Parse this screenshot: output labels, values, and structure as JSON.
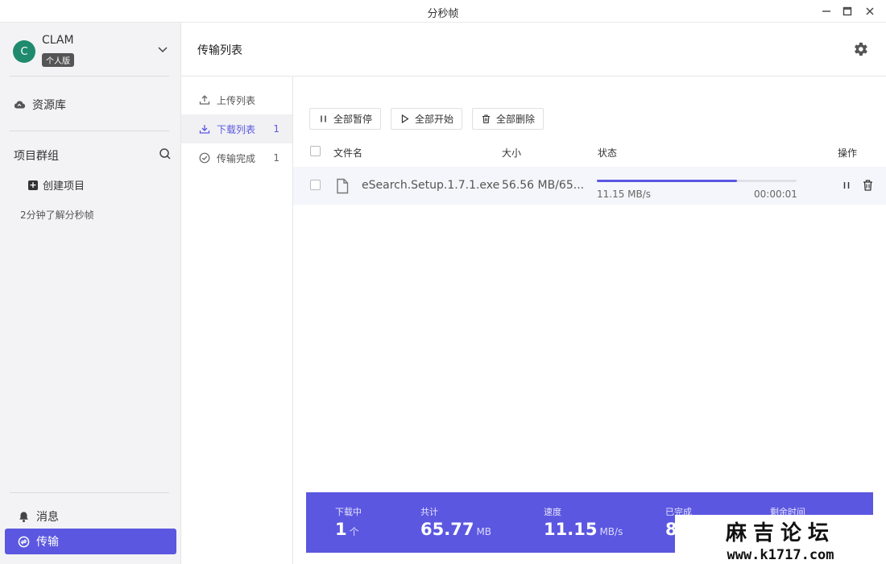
{
  "window": {
    "title": "分秒帧"
  },
  "profile": {
    "initial": "C",
    "username": "CLAM",
    "plan": "个人版"
  },
  "sidebar": {
    "library_label": "资源库",
    "project_group_label": "项目群组",
    "create_project_label": "创建项目",
    "guide_link": "2分钟了解分秒帧",
    "messages_label": "消息",
    "transfer_label": "传输"
  },
  "header": {
    "title": "传输列表"
  },
  "subnav": {
    "items": [
      {
        "label": "上传列表",
        "count": ""
      },
      {
        "label": "下载列表",
        "count": "1"
      },
      {
        "label": "传输完成",
        "count": "1"
      }
    ]
  },
  "toolbar": {
    "pause_all": "全部暂停",
    "start_all": "全部开始",
    "delete_all": "全部删除"
  },
  "table": {
    "columns": [
      "文件名",
      "大小",
      "状态",
      "操作"
    ],
    "rows": [
      {
        "filename": "eSearch.Setup.1.7.1.exe",
        "size": "56.56 MB/65...",
        "progress": 0.7,
        "speed": "11.15 MB/s",
        "eta": "00:00:01"
      }
    ]
  },
  "stats": {
    "downloading_label": "下载中",
    "downloading_value": "1",
    "downloading_unit": "个",
    "total_label": "共计",
    "total_value": "65.77",
    "total_unit": "MB",
    "speed_label": "速度",
    "speed_value": "11.15",
    "speed_unit": "MB/s",
    "completed_label": "已完成",
    "completed_value": "8",
    "remaining_label": "剩余时间"
  },
  "watermark": {
    "line1": "麻吉论坛",
    "line2": "www.k1717.com"
  },
  "colors": {
    "accent": "#5b57e0",
    "avatar": "#1f8a6e",
    "sidebar_bg": "#f3f3f5"
  }
}
